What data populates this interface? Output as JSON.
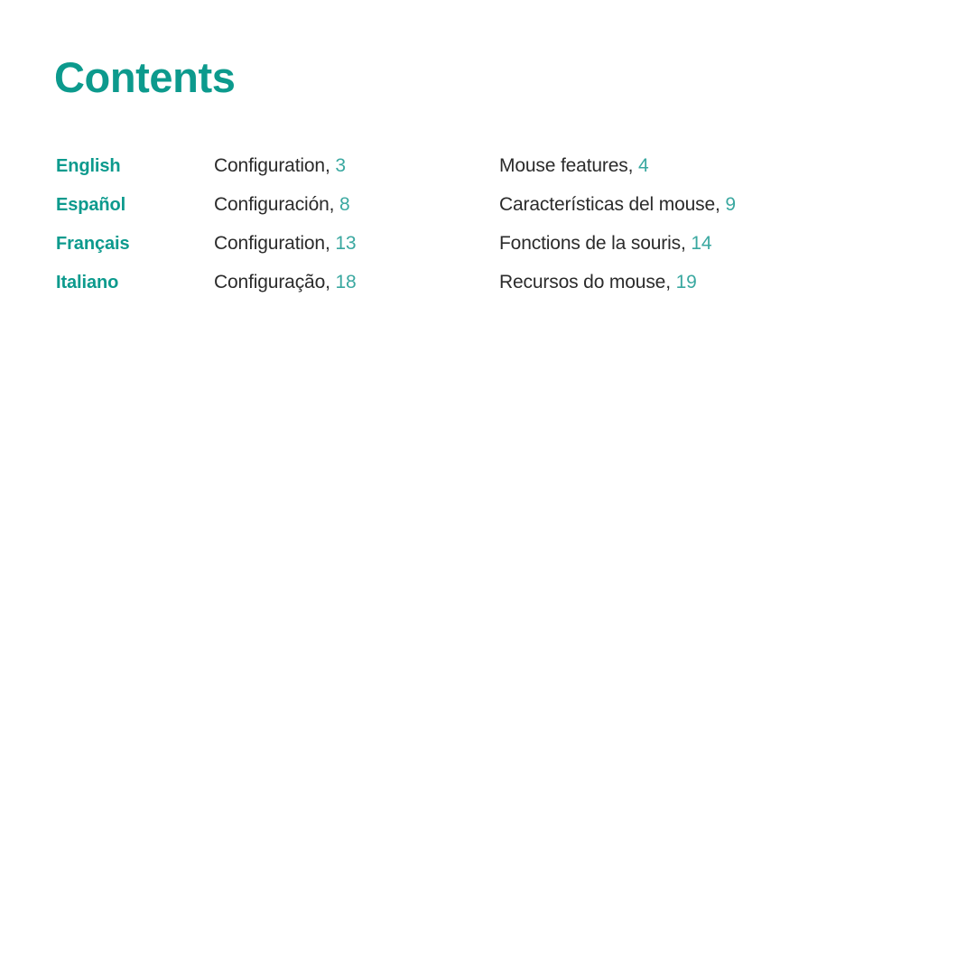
{
  "document": {
    "title": "Contents"
  },
  "colors": {
    "heading_teal": "#0c9a8d",
    "language_teal": "#0c9a8d",
    "page_number_teal": "#3aa8a0",
    "body_text": "#2b2b2b",
    "background": "#ffffff"
  },
  "contents": {
    "rows": [
      {
        "language": "English",
        "setup_label": "Configuration,",
        "setup_page": "3",
        "features_label": "Mouse features,",
        "features_page": "4"
      },
      {
        "language": "Español",
        "setup_label": "Configuración,",
        "setup_page": "8",
        "features_label": "Características del mouse,",
        "features_page": "9"
      },
      {
        "language": "Français",
        "setup_label": "Configuration,",
        "setup_page": "13",
        "features_label": "Fonctions de la souris,",
        "features_page": "14"
      },
      {
        "language": "Italiano",
        "setup_label": "Configuração,",
        "setup_page": "18",
        "features_label": "Recursos do mouse,",
        "features_page": "19"
      }
    ]
  }
}
